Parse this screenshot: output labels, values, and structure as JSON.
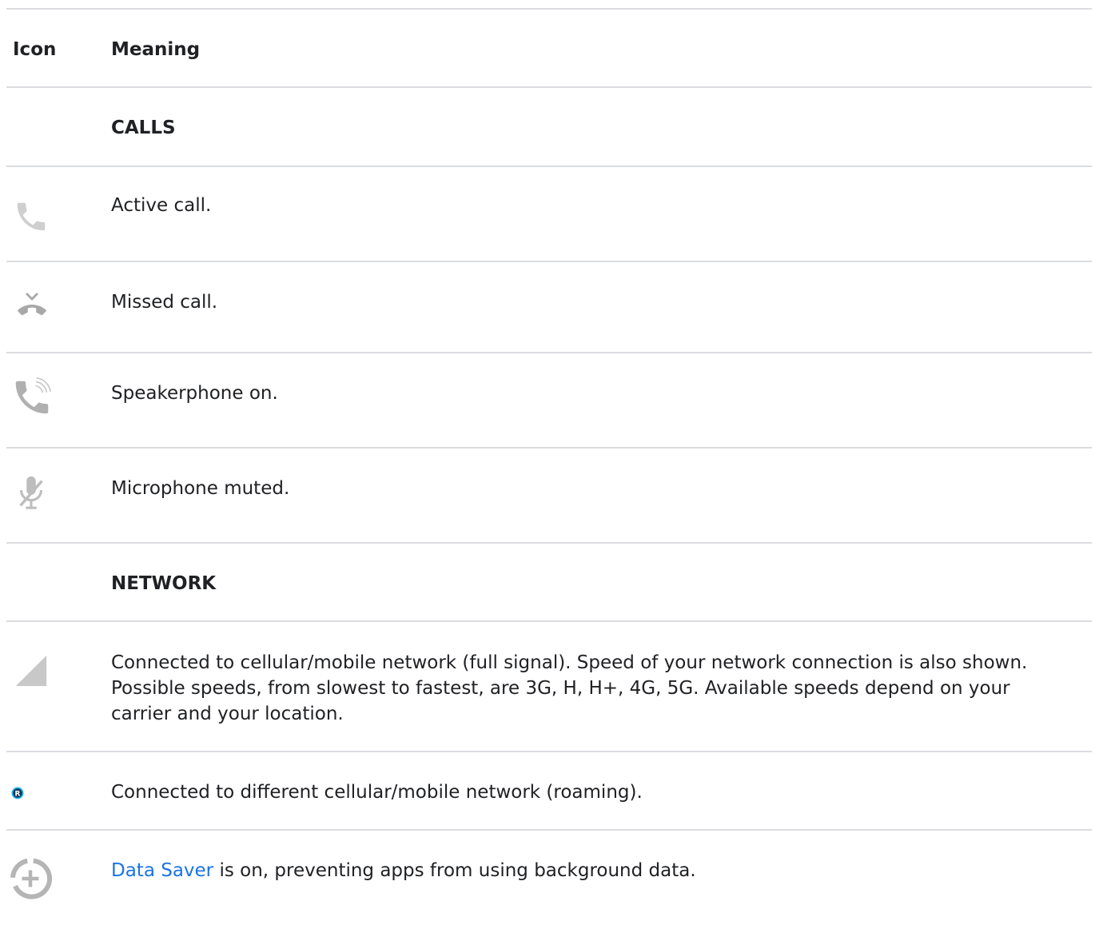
{
  "header": {
    "icon_col": "Icon",
    "meaning_col": "Meaning"
  },
  "sections": {
    "calls": "CALLS",
    "network": "NETWORK"
  },
  "rows": {
    "active_call": {
      "icon": "phone-icon",
      "text": "Active call."
    },
    "missed_call": {
      "icon": "missed-call-icon",
      "text": "Missed call."
    },
    "speakerphone": {
      "icon": "speakerphone-icon",
      "text": "Speakerphone on."
    },
    "mic_muted": {
      "icon": "mic-off-icon",
      "text": "Microphone muted."
    },
    "cellular": {
      "icon": "signal-icon",
      "text": "Connected to cellular/mobile network (full signal). Speed of your network connection is also shown. Possible speeds, from slowest to fastest, are 3G, H, H+, 4G, 5G. Available speeds depend on your carrier and your location."
    },
    "roaming": {
      "icon": "roaming-icon",
      "text": "Connected to different cellular/mobile network (roaming)."
    },
    "data_saver": {
      "icon": "data-saver-icon",
      "link_text": "Data Saver",
      "text": " is on, preventing apps from using background data."
    }
  },
  "colors": {
    "icon_gray": "#9e9e9e",
    "link": "#1a73e8",
    "roaming_blue": "#29b6f6",
    "divider": "#dadce0"
  }
}
